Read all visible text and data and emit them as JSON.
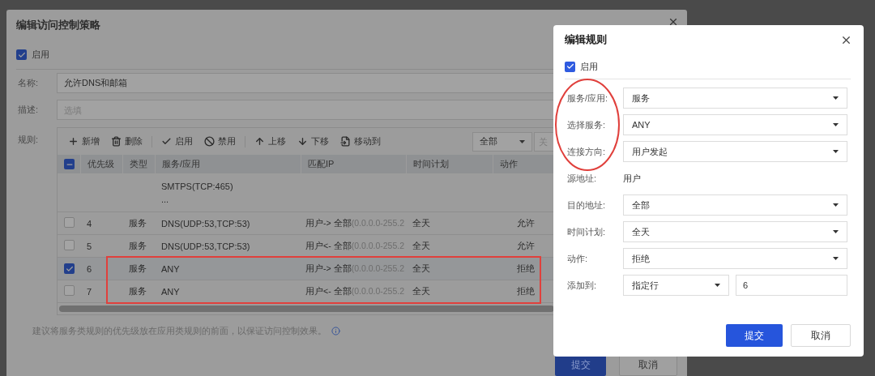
{
  "policy_dialog": {
    "title": "编辑访问控制策略",
    "enabled": {
      "label": "启用",
      "checked": true
    },
    "fields": [
      {
        "label": "名称:",
        "value": "允许DNS和邮箱"
      },
      {
        "label": "描述:",
        "placeholder": "选填"
      }
    ],
    "rules_label": "规则:",
    "toolbar": [
      "新增",
      "删除",
      "启用",
      "禁用",
      "上移",
      "下移",
      "移动到"
    ],
    "filter": {
      "value": "全部"
    },
    "filter_2": {
      "placeholder": "关"
    },
    "table": {
      "columns": [
        "优先级",
        "类型",
        "服务/应用",
        "匹配IP",
        "时间计划",
        "动作"
      ],
      "header_indeterminate": true,
      "partial_row": {
        "service_lines": [
          "SMTPS(TCP:465)",
          "..."
        ]
      },
      "rows": [
        {
          "checked": false,
          "priority": "4",
          "type": "服务",
          "service": "DNS(UDP:53,TCP:53)",
          "direction": "用户->",
          "dest": "全部",
          "range": "(0.0.0.0-255.2",
          "time": "全天",
          "action": "允许"
        },
        {
          "checked": false,
          "priority": "5",
          "type": "服务",
          "service": "DNS(UDP:53,TCP:53)",
          "direction": "用户<-",
          "dest": "全部",
          "range": "(0.0.0.0-255.2",
          "time": "全天",
          "action": "允许"
        },
        {
          "checked": true,
          "priority": "6",
          "type": "服务",
          "service": "ANY",
          "direction": "用户->",
          "dest": "全部",
          "range": "(0.0.0.0-255.2",
          "time": "全天",
          "action": "拒绝"
        },
        {
          "checked": false,
          "priority": "7",
          "type": "服务",
          "service": "ANY",
          "direction": "用户<-",
          "dest": "全部",
          "range": "(0.0.0.0-255.2",
          "time": "全天",
          "action": "拒绝"
        }
      ]
    },
    "hint": "建议将服务类规则的优先级放在应用类规则的前面，以保证访问控制效果。",
    "buttons": [
      "提交",
      "取消"
    ]
  },
  "rule_dialog": {
    "title": "编辑规则",
    "enabled": {
      "label": "启用",
      "checked": true
    },
    "fields": [
      {
        "kind": "select",
        "label": "服务/应用:",
        "value": "服务"
      },
      {
        "kind": "select",
        "label": "选择服务:",
        "value": "ANY"
      },
      {
        "kind": "select",
        "label": "连接方向:",
        "value": "用户发起"
      },
      {
        "kind": "text",
        "label": "源地址:",
        "value": "用户"
      },
      {
        "kind": "select",
        "label": "目的地址:",
        "value": "全部"
      },
      {
        "kind": "select",
        "label": "时间计划:",
        "value": "全天"
      },
      {
        "kind": "select",
        "label": "动作:",
        "value": "拒绝"
      },
      {
        "kind": "split",
        "label": "添加到:",
        "value": "指定行",
        "value_2": "6"
      }
    ],
    "buttons": [
      "提交",
      "取消"
    ]
  }
}
